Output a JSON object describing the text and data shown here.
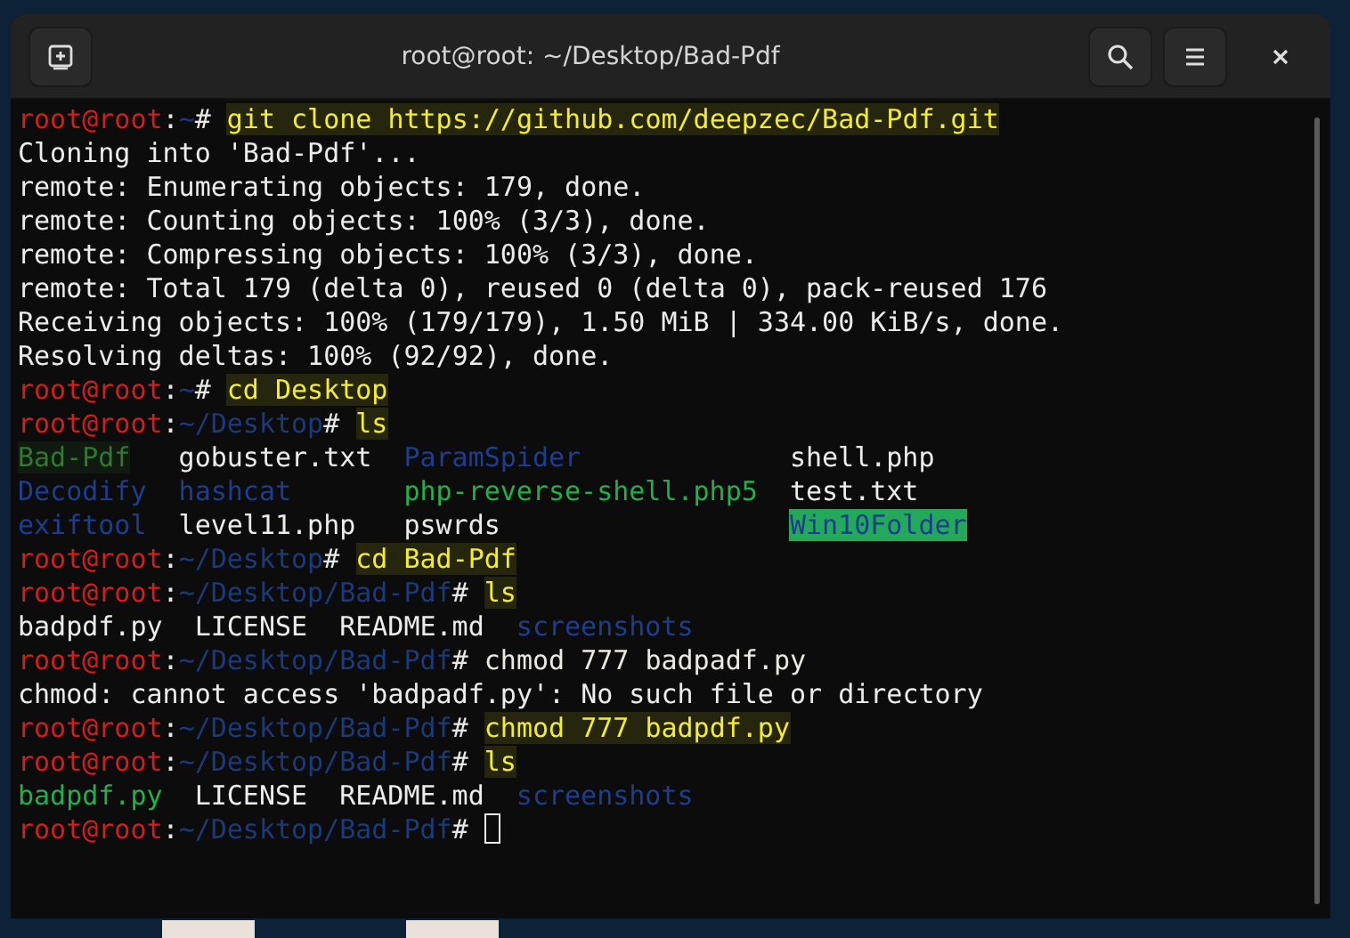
{
  "window": {
    "title": "root@root: ~/Desktop/Bad-Pdf"
  },
  "terminal": {
    "lines": [
      {
        "kind": "prompt",
        "user": "root@root",
        "sep": ":",
        "path": "~",
        "sign": "#",
        "command": "git clone https://github.com/deepzec/Bad-Pdf.git",
        "highlighted": true
      },
      {
        "kind": "output",
        "text": "Cloning into 'Bad-Pdf'..."
      },
      {
        "kind": "output",
        "text": "remote: Enumerating objects: 179, done."
      },
      {
        "kind": "output",
        "text": "remote: Counting objects: 100% (3/3), done."
      },
      {
        "kind": "output",
        "text": "remote: Compressing objects: 100% (3/3), done."
      },
      {
        "kind": "output",
        "text": "remote: Total 179 (delta 0), reused 0 (delta 0), pack-reused 176"
      },
      {
        "kind": "output",
        "text": "Receiving objects: 100% (179/179), 1.50 MiB | 334.00 KiB/s, done."
      },
      {
        "kind": "output",
        "text": "Resolving deltas: 100% (92/92), done."
      },
      {
        "kind": "prompt",
        "user": "root@root",
        "sep": ":",
        "path": "~",
        "sign": "#",
        "command": "cd Desktop",
        "highlighted": true
      },
      {
        "kind": "prompt",
        "user": "root@root",
        "sep": ":",
        "path": "~/Desktop",
        "sign": "#",
        "command": "ls",
        "highlighted": true
      },
      {
        "kind": "listing-grid",
        "rows": [
          [
            {
              "name": "Bad-Pdf",
              "kind": "marked-dir"
            },
            {
              "name": "gobuster.txt",
              "kind": "file"
            },
            {
              "name": "ParamSpider",
              "kind": "dir"
            },
            {
              "name": "shell.php",
              "kind": "file"
            }
          ],
          [
            {
              "name": "Decodify",
              "kind": "dir"
            },
            {
              "name": "hashcat",
              "kind": "dir"
            },
            {
              "name": "php-reverse-shell.php5",
              "kind": "exec"
            },
            {
              "name": "test.txt",
              "kind": "file"
            }
          ],
          [
            {
              "name": "exiftool",
              "kind": "dir"
            },
            {
              "name": "level11.php",
              "kind": "file"
            },
            {
              "name": "pswrds",
              "kind": "file"
            },
            {
              "name": "Win10Folder",
              "kind": "writable-dir"
            }
          ]
        ]
      },
      {
        "kind": "prompt",
        "user": "root@root",
        "sep": ":",
        "path": "~/Desktop",
        "sign": "#",
        "command": "cd Bad-Pdf",
        "highlighted": true
      },
      {
        "kind": "prompt",
        "user": "root@root",
        "sep": ":",
        "path": "~/Desktop/Bad-Pdf",
        "sign": "#",
        "command": "ls",
        "highlighted": true
      },
      {
        "kind": "listing-row",
        "rows": [
          [
            {
              "name": "badpdf.py",
              "kind": "file"
            },
            {
              "name": "LICENSE",
              "kind": "file"
            },
            {
              "name": "README.md",
              "kind": "file"
            },
            {
              "name": "screenshots",
              "kind": "dir"
            }
          ]
        ]
      },
      {
        "kind": "prompt",
        "user": "root@root",
        "sep": ":",
        "path": "~/Desktop/Bad-Pdf",
        "sign": "#",
        "command": "chmod 777 badpadf.py",
        "highlighted": false
      },
      {
        "kind": "output",
        "text": "chmod: cannot access 'badpadf.py': No such file or directory"
      },
      {
        "kind": "prompt",
        "user": "root@root",
        "sep": ":",
        "path": "~/Desktop/Bad-Pdf",
        "sign": "#",
        "command": "chmod 777 badpdf.py",
        "highlighted": true
      },
      {
        "kind": "prompt",
        "user": "root@root",
        "sep": ":",
        "path": "~/Desktop/Bad-Pdf",
        "sign": "#",
        "command": "ls",
        "highlighted": true
      },
      {
        "kind": "listing-row",
        "rows": [
          [
            {
              "name": "badpdf.py",
              "kind": "exec"
            },
            {
              "name": "LICENSE",
              "kind": "file"
            },
            {
              "name": "README.md",
              "kind": "file"
            },
            {
              "name": "screenshots",
              "kind": "dir"
            }
          ]
        ]
      },
      {
        "kind": "prompt",
        "user": "root@root",
        "sep": ":",
        "path": "~/Desktop/Bad-Pdf",
        "sign": "#",
        "cursor": true
      }
    ]
  }
}
